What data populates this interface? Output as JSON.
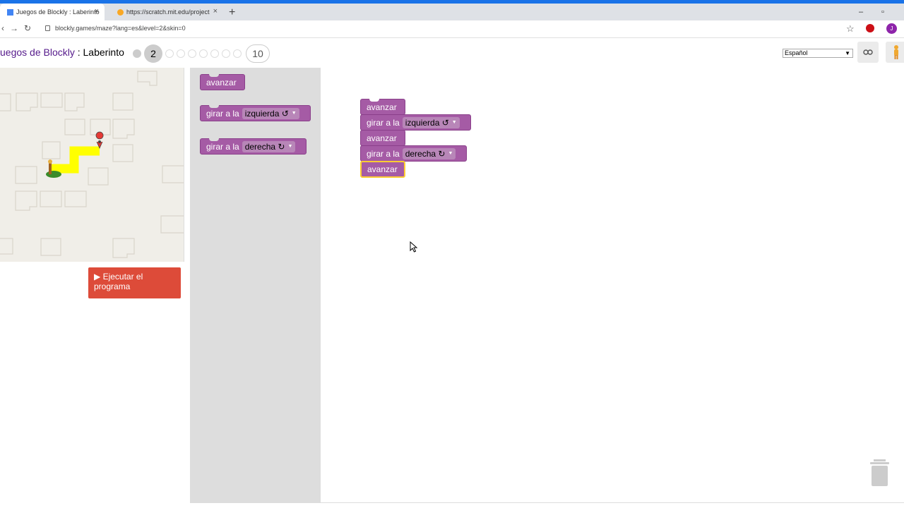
{
  "browser": {
    "tabs": [
      {
        "title": "Juegos de Blockly : Laberinto",
        "close": "×"
      },
      {
        "title": "https://scratch.mit.edu/projects/...",
        "close": "×"
      }
    ],
    "new_tab": "+",
    "url": "blockly.games/maze?lang=es&level=2&skin=0",
    "profile_initial": "J",
    "window_controls": {
      "minimize": "–",
      "maximize": "▫"
    }
  },
  "header": {
    "title_link": "uegos de Blockly",
    "title_separator": " : ",
    "title_page": "Laberinto",
    "levels": {
      "current": "2",
      "last": "10",
      "completed": 1,
      "remaining": 7
    },
    "language": "Español",
    "link_icon": "link-icon",
    "pegman_icon": "pegman-icon"
  },
  "run_button": {
    "icon": "play-icon",
    "label": "Ejecutar el programa"
  },
  "toolbox": {
    "move": {
      "label": "avanzar"
    },
    "turn_left": {
      "label": "girar a la",
      "option": "izquierda ↺"
    },
    "turn_right": {
      "label": "girar a la",
      "option": "derecha ↻"
    }
  },
  "workspace": {
    "blocks": [
      {
        "label": "avanzar"
      },
      {
        "label": "girar a la",
        "option": "izquierda ↺"
      },
      {
        "label": "avanzar"
      },
      {
        "label": "girar a la",
        "option": "derecha ↻"
      },
      {
        "label": "avanzar",
        "selected": true
      }
    ]
  },
  "colors": {
    "block": "#a55ba5",
    "path": "#ffff00",
    "run": "#dd4b39",
    "selected_border": "#ffcc33"
  }
}
